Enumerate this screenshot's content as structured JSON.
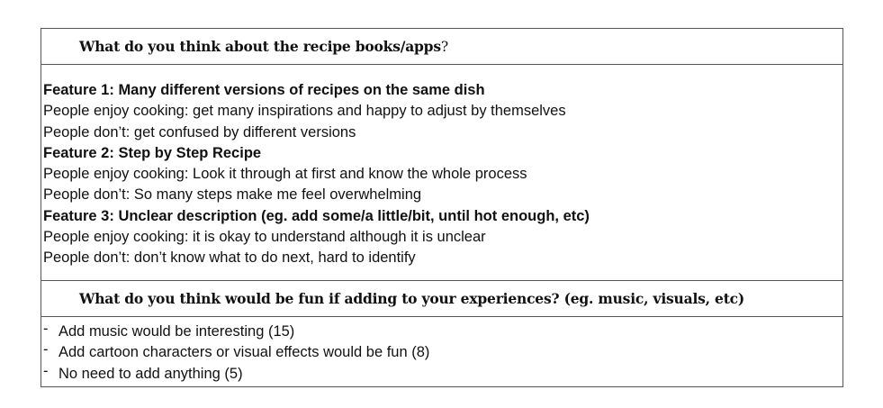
{
  "section1": {
    "question": "What do you think about the recipe books/apps",
    "question_mark": "?",
    "lines": [
      {
        "text": "Feature 1: Many different versions of recipes on the same dish",
        "bold": true
      },
      {
        "text": "People enjoy cooking: get many inspirations and happy to adjust by themselves",
        "bold": false
      },
      {
        "text": "People don’t: get confused by different versions",
        "bold": false
      },
      {
        "text": "Feature 2: Step by Step Recipe",
        "bold": true
      },
      {
        "text": "People enjoy cooking: Look it through at first and know the whole process",
        "bold": false
      },
      {
        "text": "People don’t: So many steps make me feel overwhelming",
        "bold": false
      },
      {
        "text": "Feature 3: Unclear description (eg. add some/a little/bit, until hot enough, etc)",
        "bold": true
      },
      {
        "text": "People enjoy cooking: it is okay to understand although it is unclear",
        "bold": false
      },
      {
        "text": "People don’t: don’t know what to do next, hard to identify",
        "bold": false
      }
    ]
  },
  "section2": {
    "question": "What do you think would be fun if adding to your experiences? (eg. music, visuals, etc)",
    "bullet": "-",
    "items": [
      "Add music would be interesting (15)",
      "Add cartoon characters or visual effects would be fun (8)",
      "No need to add anything (5)"
    ]
  }
}
